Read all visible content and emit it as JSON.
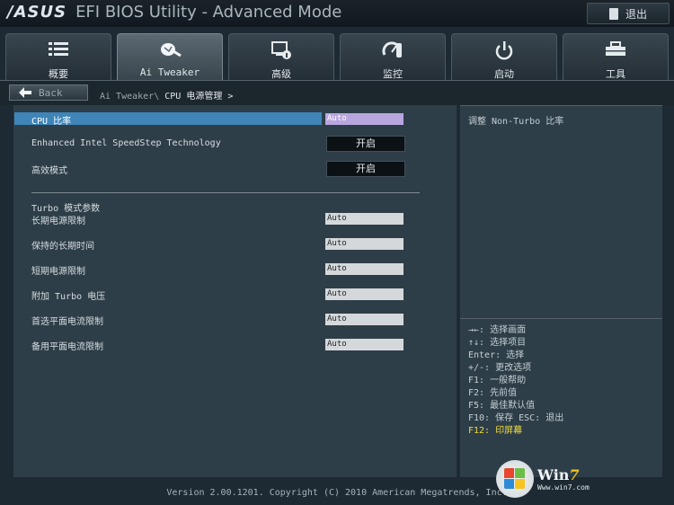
{
  "header": {
    "brand": "/ASUS",
    "title": "EFI BIOS Utility - Advanced Mode",
    "exit_label": "退出"
  },
  "tabs": [
    {
      "label": "概要",
      "icon": "list-icon",
      "active": false
    },
    {
      "label": "Ai Tweaker",
      "icon": "ai-tweaker-icon",
      "active": true
    },
    {
      "label": "高级",
      "icon": "advanced-settings-icon",
      "active": false
    },
    {
      "label": "监控",
      "icon": "monitor-gauge-icon",
      "active": false
    },
    {
      "label": "启动",
      "icon": "power-icon",
      "active": false
    },
    {
      "label": "工具",
      "icon": "tool-icon",
      "active": false
    }
  ],
  "nav": {
    "back_label": "Back",
    "breadcrumb_parent": "Ai Tweaker\\",
    "breadcrumb_current": "CPU 电源管理 >"
  },
  "settings": {
    "cpu_ratio": {
      "label": "CPU 比率",
      "value": "Auto"
    },
    "speedstep": {
      "label": "Enhanced Intel SpeedStep Technology",
      "value": "开启"
    },
    "efficiency_mode": {
      "label": "高效模式",
      "value": "开启"
    }
  },
  "turbo": {
    "heading": "Turbo 模式参数",
    "items": [
      {
        "label": "长期电源限制",
        "value": "Auto"
      },
      {
        "label": "保持的长期时间",
        "value": "Auto"
      },
      {
        "label": "短期电源限制",
        "value": "Auto"
      },
      {
        "label": "附加 Turbo 电压",
        "value": "Auto"
      },
      {
        "label": "首选平面电流限制",
        "value": "Auto"
      },
      {
        "label": "备用平面电流限制",
        "value": "Auto"
      }
    ]
  },
  "side": {
    "description": "调整 Non-Turbo 比率",
    "help": [
      "→←: 选择画面",
      "↑↓: 选择项目",
      "Enter: 选择",
      "+/-: 更改选项",
      "F1: 一般帮助",
      "F2: 先前值",
      "F5: 最佳默认值",
      "F10: 保存  ESC: 退出"
    ],
    "help_highlight": "F12: 印屏幕"
  },
  "footer": {
    "version": "Version 2.00.1201. Copyright (C) 2010 American Megatrends, Inc."
  },
  "watermark": {
    "word_win": "Win",
    "word_seven": "7",
    "url": "Www.win7.com"
  },
  "colors": {
    "selected_row": "#3f85b8",
    "selected_value": "#b9a6df",
    "help_highlight": "#f2dd3c"
  }
}
